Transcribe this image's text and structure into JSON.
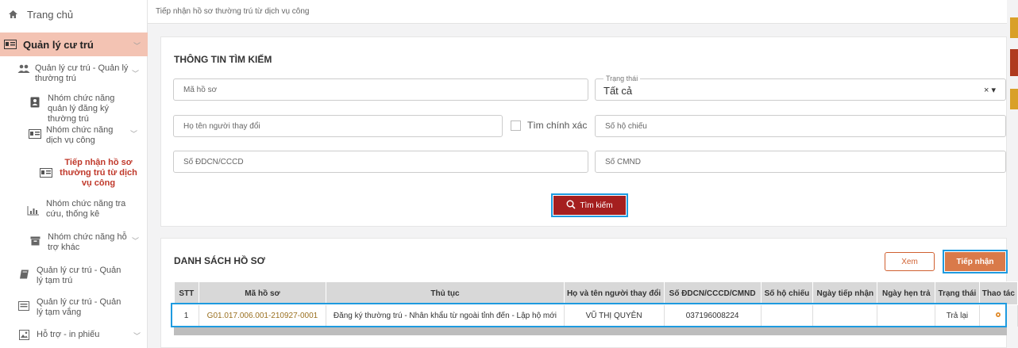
{
  "sidebar": {
    "home": "Trang chủ",
    "quan_ly_cu_tru": "Quản lý cư trú",
    "thuong_tru": "Quản lý cư trú - Quản lý thường trú",
    "nhom_dang_ky": "Nhóm chức năng quản lý đăng ký thường trú",
    "nhom_dich_vu": "Nhóm chức năng dịch vụ công",
    "tiep_nhan": "Tiếp nhận hồ sơ thường trú từ dịch vụ công",
    "tra_cuu": "Nhóm chức năng tra cứu, thống kê",
    "ho_tro_khac": "Nhóm chức năng hỗ trợ khác",
    "tam_tru": "Quản lý cư trú - Quản lý tạm trú",
    "tam_vang": "Quản lý cư trú - Quản lý tạm vắng",
    "in_phieu": "Hỗ trợ - in phiếu"
  },
  "breadcrumb": "Tiếp nhận hồ sơ thường trú từ dịch vụ công",
  "search": {
    "title": "THÔNG TIN TÌM KIẾM",
    "ma_ho_so": "Mã hồ sơ",
    "trang_thai_label": "Trạng thái",
    "trang_thai_value": "Tất cả",
    "ho_ten": "Họ tên người thay đổi",
    "tim_chinh_xac": "Tìm chính xác",
    "so_ho_chieu": "Số hộ chiếu",
    "so_ddcn": "Số ĐDCN/CCCD",
    "so_cmnd": "Số CMND",
    "button": "Tìm kiếm"
  },
  "list": {
    "title": "DANH SÁCH HỒ SƠ",
    "xem": "Xem",
    "tiep_nhan": "Tiếp nhận",
    "headers": [
      "STT",
      "Mã hồ sơ",
      "Thủ tục",
      "Họ và tên người thay đổi",
      "Số ĐDCN/CCCD/CMND",
      "Số hộ chiếu",
      "Ngày tiếp nhận",
      "Ngày hẹn trả",
      "Trạng thái",
      "Thao tác"
    ],
    "rows": [
      [
        "1",
        "G01.017.006.001-210927-0001",
        "Đăng ký thường trú - Nhân khẩu từ ngoài tỉnh đến - Lập hộ mới",
        "VŨ THỊ QUYÊN",
        "037196008224",
        "",
        "",
        "",
        "Trả lại",
        ""
      ]
    ]
  },
  "colors": {
    "accent_red": "#a51f1f",
    "accent_orange": "#d97a4a",
    "highlight_blue": "#1e9be0"
  }
}
